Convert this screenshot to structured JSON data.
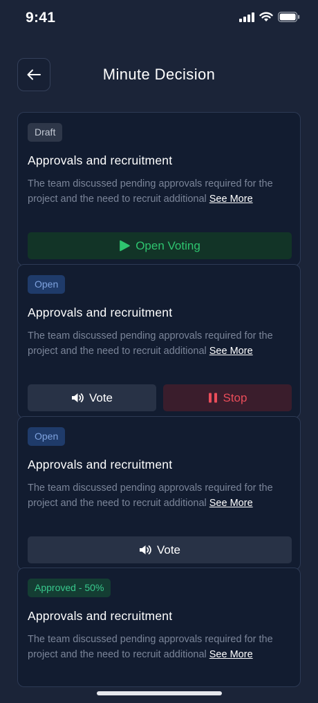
{
  "status_bar": {
    "time": "9:41"
  },
  "header": {
    "title": "Minute Decision"
  },
  "cards": [
    {
      "status": "Draft",
      "title": "Approvals and recruitment",
      "description": "The team discussed pending approvals required for the project and the need to recruit additional",
      "see_more": "See More",
      "actions": [
        {
          "label": "Open Voting",
          "icon": "play-icon"
        }
      ]
    },
    {
      "status": "Open",
      "title": "Approvals and recruitment",
      "description": "The team discussed pending approvals required for the project and the need to recruit additional",
      "see_more": "See More",
      "actions": [
        {
          "label": "Vote",
          "icon": "speaker-icon"
        },
        {
          "label": "Stop",
          "icon": "pause-icon"
        }
      ]
    },
    {
      "status": "Open",
      "title": "Approvals and recruitment",
      "description": "The team discussed pending approvals required for the project and the need to recruit additional",
      "see_more": "See More",
      "actions": [
        {
          "label": "Vote",
          "icon": "speaker-icon"
        }
      ]
    },
    {
      "status": "Approved - 50%",
      "title": "Approvals and recruitment",
      "description": "The team discussed pending approvals required for the project and the need to recruit additional",
      "see_more": "See More",
      "actions": []
    }
  ],
  "colors": {
    "background": "#1b2438",
    "card": "#121c30",
    "green": "#2ec46f",
    "red": "#ea4d5a",
    "blue_badge": "#1f3b6a"
  }
}
